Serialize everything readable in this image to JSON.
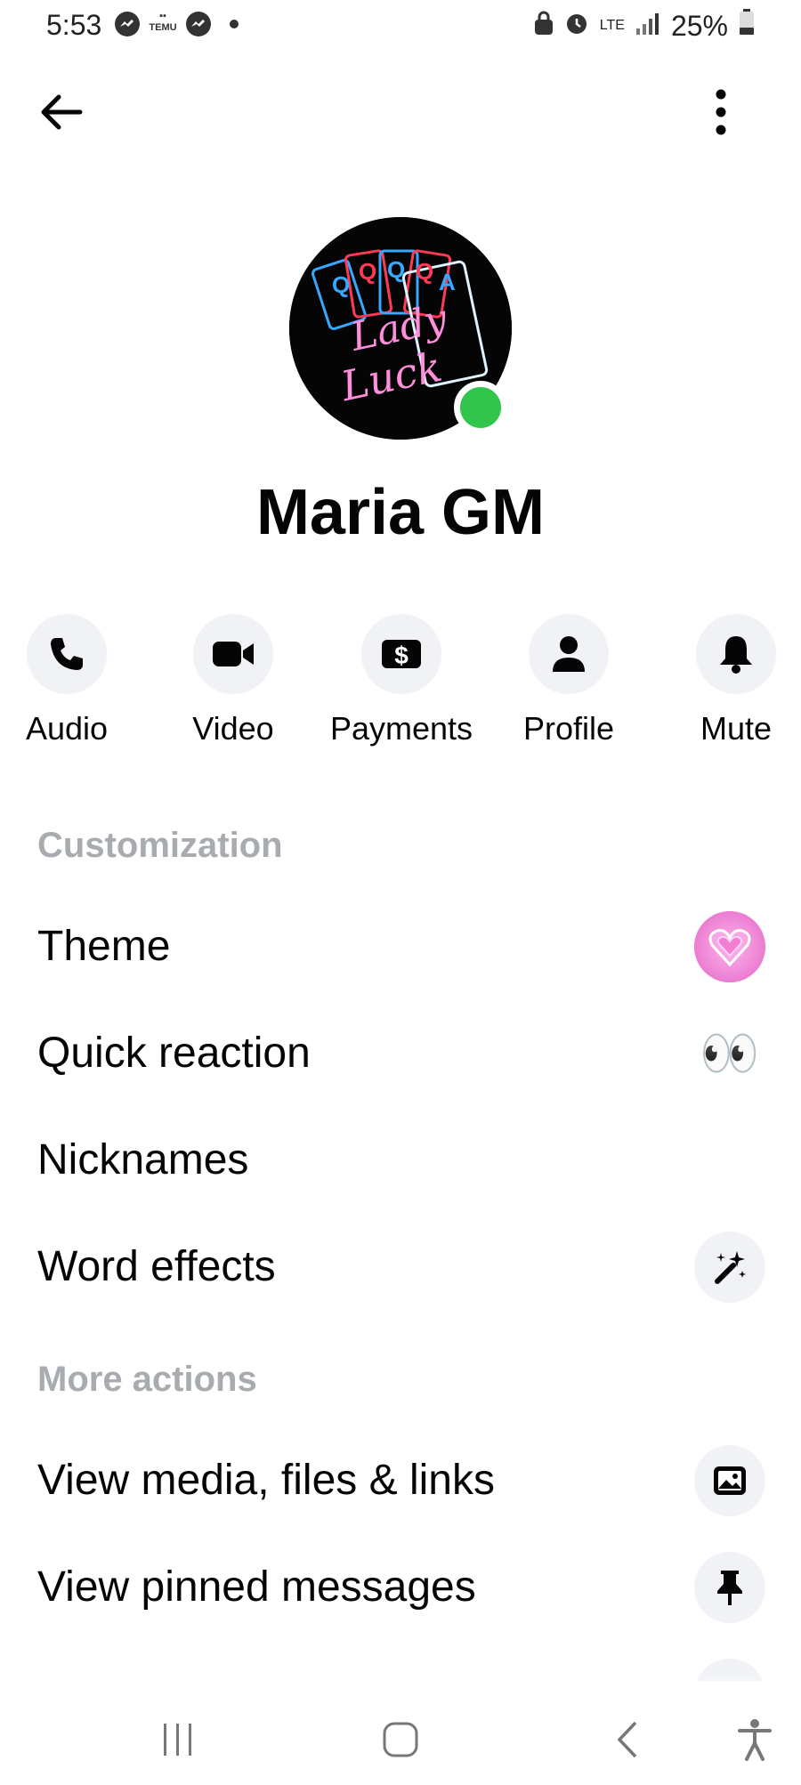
{
  "status_bar": {
    "time": "5:53",
    "network": "LTE",
    "battery": "25%",
    "left_icons": [
      "messenger-icon",
      "temu-icon",
      "messenger-icon",
      "dot-icon"
    ],
    "right_icons": [
      "lock-icon",
      "alarm-icon",
      "lte-icon",
      "signal-icon",
      "battery-icon"
    ]
  },
  "header": {
    "back_icon": "arrow-left-icon",
    "menu_icon": "more-vertical-icon"
  },
  "profile": {
    "name": "Maria GM",
    "avatar_text": [
      "Lady",
      "Luck"
    ],
    "avatar_cards": [
      "Q",
      "Q",
      "Q",
      "Q",
      "A"
    ],
    "online": true,
    "online_color": "#31c54b"
  },
  "actions": [
    {
      "label": "Audio",
      "icon": "phone-icon"
    },
    {
      "label": "Video",
      "icon": "video-camera-icon"
    },
    {
      "label": "Payments",
      "icon": "dollar-icon"
    },
    {
      "label": "Profile",
      "icon": "person-icon"
    },
    {
      "label": "Mute",
      "icon": "bell-icon"
    }
  ],
  "customization": {
    "title": "Customization",
    "items": [
      {
        "label": "Theme",
        "icon": "heart-theme-icon"
      },
      {
        "label": "Quick reaction",
        "icon": "eyes-emoji",
        "emoji": "👀"
      },
      {
        "label": "Nicknames",
        "icon": ""
      },
      {
        "label": "Word effects",
        "icon": "sparkle-wand-icon"
      }
    ]
  },
  "more_actions": {
    "title": "More actions",
    "items": [
      {
        "label": "View media, files & links",
        "icon": "image-icon"
      },
      {
        "label": "View pinned messages",
        "icon": "pin-icon"
      }
    ]
  },
  "nav_bar": {
    "buttons": [
      "recent-apps-icon",
      "home-icon",
      "back-icon",
      "accessibility-icon"
    ]
  },
  "colors": {
    "section_title": "#a8abaf",
    "icon_bg": "#f0f2f5",
    "theme_pink": "#f08fd8"
  }
}
